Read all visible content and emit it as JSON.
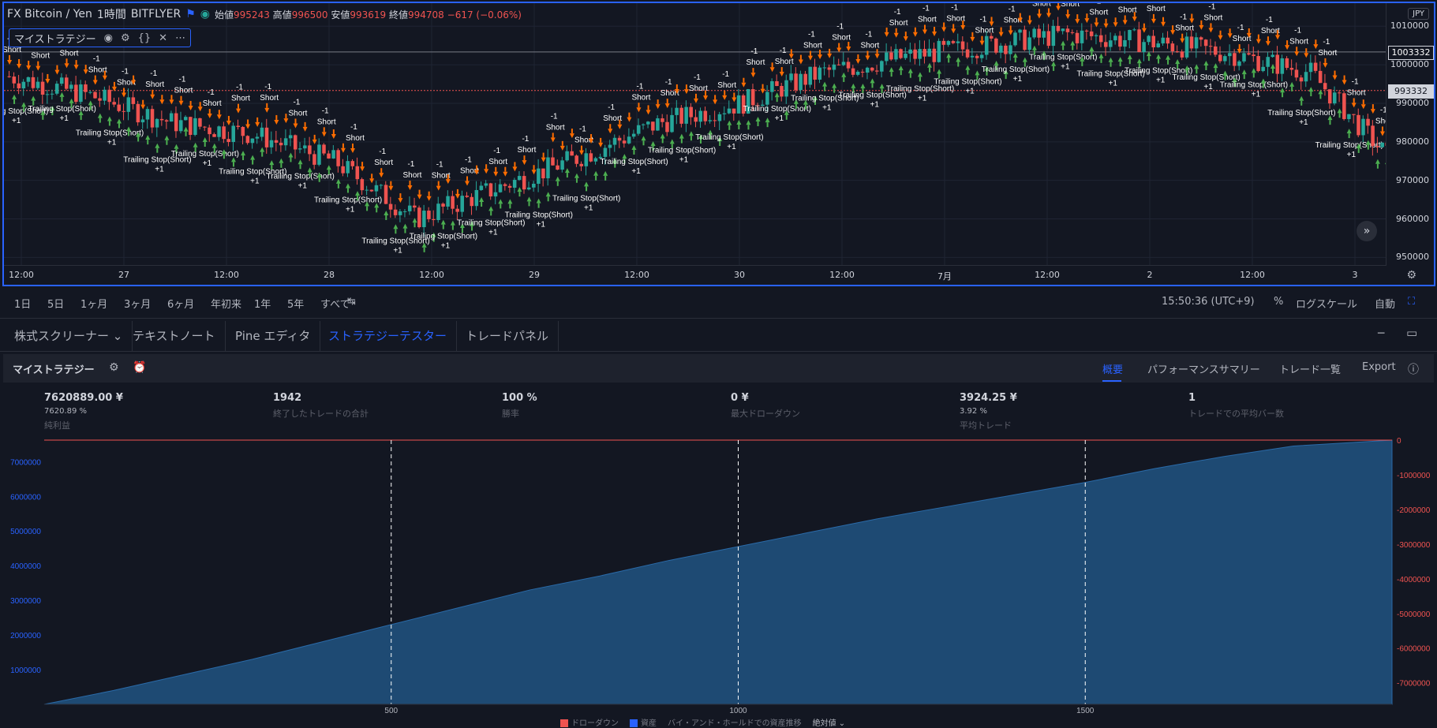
{
  "symbol": {
    "name": "FX Bitcoin / Yen",
    "interval": "1時間",
    "exchange": "BITFLYER",
    "ohlc": {
      "open_label": "始値",
      "open": "995243",
      "high_label": "高値",
      "high": "996500",
      "low_label": "安値",
      "low": "993619",
      "close_label": "終値",
      "close": "994708",
      "change": "−617 (−0.06%)"
    }
  },
  "strategy_legend": {
    "name": "マイストラテジー"
  },
  "currency": "JPY",
  "price_axis": {
    "ticks": [
      {
        "label": "1010000",
        "value": 1010000
      },
      {
        "label": "1000000",
        "value": 1000000
      },
      {
        "label": "990000",
        "value": 990000
      },
      {
        "label": "980000",
        "value": 980000
      },
      {
        "label": "970000",
        "value": 970000
      },
      {
        "label": "960000",
        "value": 960000
      },
      {
        "label": "950000",
        "value": 950000
      }
    ],
    "badges": [
      {
        "label": "1003332",
        "value": 1003332,
        "color": "#ffffff",
        "bg": "#131722",
        "border": "#d1d4dc"
      },
      {
        "label": "993332",
        "value": 993332,
        "color": "#131722",
        "bg": "#d1d4dc",
        "border": "#d1d4dc"
      }
    ],
    "range": [
      947000,
      1016000
    ]
  },
  "time_axis": {
    "ticks": [
      "12:00",
      "27",
      "12:00",
      "28",
      "12:00",
      "29",
      "12:00",
      "30",
      "12:00",
      "7月",
      "12:00",
      "2",
      "12:00",
      "3"
    ]
  },
  "annotations": {
    "short_label": "Short",
    "trailing_label": "Trailing Stop(Short)",
    "minus_label": "-1",
    "plus_label": "+1",
    "colors": {
      "short_arrow": "#ff6d00",
      "long_arrow": "#4caf50",
      "up_candle": "#26a69a",
      "down_candle": "#ef5350"
    }
  },
  "range_bar": {
    "buttons": [
      "1日",
      "5日",
      "1ヶ月",
      "3ヶ月",
      "6ヶ月",
      "年初来",
      "1年",
      "5年",
      "すべて"
    ],
    "time": "15:50:36 (UTC+9)",
    "percent": "%",
    "log": "ログスケール",
    "auto": "自動"
  },
  "panel_tabs": [
    {
      "label": "株式スクリーナー ⌄",
      "active": false
    },
    {
      "label": "テキストノート",
      "active": false
    },
    {
      "label": "Pine エディタ",
      "active": false
    },
    {
      "label": "ストラテジーテスター",
      "active": true
    },
    {
      "label": "トレードパネル",
      "active": false
    }
  ],
  "strategy_header": {
    "title": "マイストラテジー",
    "links": [
      {
        "label": "概要",
        "active": true
      },
      {
        "label": "パフォーマンスサマリー",
        "active": false
      },
      {
        "label": "トレード一覧",
        "active": false
      },
      {
        "label": "Export",
        "active": false
      }
    ]
  },
  "stats": [
    {
      "main": "7620889.00 ¥",
      "sub": "7620.89 %",
      "label": "純利益"
    },
    {
      "main": "1942",
      "sub": "",
      "label": "終了したトレードの合計"
    },
    {
      "main": "100 %",
      "sub": "",
      "label": "勝率"
    },
    {
      "main": "0 ¥",
      "sub": "",
      "label": "最大ドローダウン"
    },
    {
      "main": "3924.25 ¥",
      "sub": "3.92 %",
      "label": "平均トレード"
    },
    {
      "main": "1",
      "sub": "",
      "label": "トレードでの平均バー数"
    }
  ],
  "chart_data": {
    "type": "area",
    "x_ticks": [
      "500",
      "1000",
      "1500"
    ],
    "x_tick_values": [
      500,
      1000,
      1500
    ],
    "xlim": [
      0,
      1942
    ],
    "left_axis": {
      "ticks": [
        "1000000",
        "2000000",
        "3000000",
        "4000000",
        "5000000",
        "6000000",
        "7000000"
      ],
      "values": [
        1000000,
        2000000,
        3000000,
        4000000,
        5000000,
        6000000,
        7000000
      ],
      "ylim": [
        0,
        7620889
      ]
    },
    "right_axis": {
      "ticks": [
        "0",
        "-1000000",
        "-2000000",
        "-3000000",
        "-4000000",
        "-5000000",
        "-6000000",
        "-7000000"
      ],
      "values": [
        0,
        -1000000,
        -2000000,
        -3000000,
        -4000000,
        -5000000,
        -6000000,
        -7000000
      ]
    },
    "series": [
      {
        "name": "資産",
        "type": "area",
        "color": "#1e4a73",
        "x": [
          0,
          100,
          200,
          300,
          400,
          500,
          600,
          700,
          800,
          900,
          1000,
          1100,
          1200,
          1300,
          1400,
          1500,
          1600,
          1700,
          1800,
          1942
        ],
        "values": [
          0,
          400000,
          850000,
          1300000,
          1800000,
          2300000,
          2800000,
          3300000,
          3700000,
          4150000,
          4550000,
          4950000,
          5350000,
          5700000,
          6050000,
          6400000,
          6800000,
          7150000,
          7450000,
          7620889
        ]
      },
      {
        "name": "ドローダウン",
        "type": "line",
        "color": "#ef5350",
        "x": [
          0,
          1942
        ],
        "values": [
          0,
          0
        ]
      }
    ],
    "legend": [
      {
        "label": "ドローダウン",
        "color": "#ef5350"
      },
      {
        "label": "資産",
        "color": "#2962ff"
      },
      {
        "label": "バイ・アンド・ホールドでの資産推移",
        "color": "#787b86"
      },
      {
        "label": "絶対値 ⌄",
        "color": "#b2b5be"
      }
    ]
  }
}
